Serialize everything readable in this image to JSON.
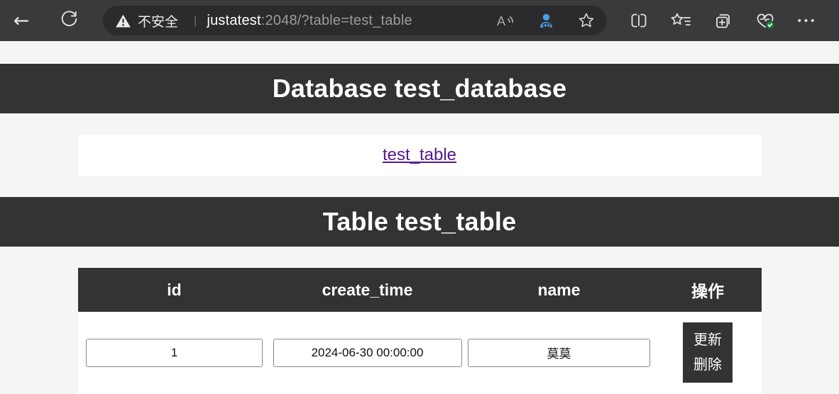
{
  "browser": {
    "back_glyph": "←",
    "more_glyph": "•••",
    "address": {
      "security_label": "不安全",
      "divider": "|",
      "host": "justatest",
      "path": ":2048/?table=test_table"
    },
    "icons": {
      "back": "back-arrow",
      "refresh": "refresh-circular-arrow",
      "warning": "warning-triangle",
      "read_aloud": "read-aloud-A-waves",
      "profile": "profile-person-sync-blue",
      "bookmark": "favorite-star-outline",
      "split_screen": "split-screen",
      "favorites": "favorites-star-with-lines",
      "collections": "collections-squares-plus",
      "essentials": "browser-essentials-heart-check",
      "more": "three-dots"
    }
  },
  "content": {
    "database_heading": "Database test_database",
    "table_links": [
      {
        "label": "test_table"
      }
    ],
    "table_heading": "Table test_table",
    "table": {
      "columns": [
        "id",
        "create_time",
        "name",
        "操作"
      ],
      "rows": [
        {
          "id": "1",
          "create_time": "2024-06-30 00:00:00",
          "name": "莫莫"
        }
      ],
      "update_label": "更新",
      "delete_label": "删除"
    }
  },
  "colors": {
    "toolbar_bg": "#3a3a3c",
    "address_bar_bg": "#2b2b2d",
    "band_bg": "#333333",
    "page_bg": "#f5f5f5",
    "link_visited": "#551a8b",
    "profile_blue": "#4a9ee4",
    "essentials_green": "#178a3c"
  }
}
